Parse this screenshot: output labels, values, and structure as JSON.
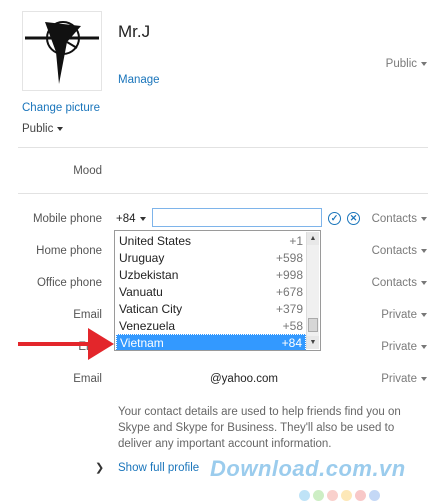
{
  "profile": {
    "name": "Mr.J",
    "manage_link": "Manage",
    "change_picture_link": "Change picture",
    "picture_privacy": "Public",
    "profile_privacy": "Public"
  },
  "mood": {
    "label": "Mood"
  },
  "mobile_phone": {
    "label": "Mobile phone",
    "country_code": "+84",
    "value": "",
    "privacy": "Contacts"
  },
  "home_phone": {
    "label": "Home phone",
    "privacy": "Contacts"
  },
  "office_phone": {
    "label": "Office phone",
    "privacy": "Contacts"
  },
  "emails": [
    {
      "label": "Email",
      "value": "",
      "privacy": "Private"
    },
    {
      "label": "Ema",
      "value": "",
      "privacy": "Private"
    },
    {
      "label": "Email",
      "value": "@yahoo.com",
      "privacy": "Private"
    }
  ],
  "country_dropdown": {
    "items": [
      {
        "country": "United States",
        "code": "+1"
      },
      {
        "country": "Uruguay",
        "code": "+598"
      },
      {
        "country": "Uzbekistan",
        "code": "+998"
      },
      {
        "country": "Vanuatu",
        "code": "+678"
      },
      {
        "country": "Vatican City",
        "code": "+379"
      },
      {
        "country": "Venezuela",
        "code": "+58"
      },
      {
        "country": "Vietnam",
        "code": "+84"
      }
    ],
    "selected_index": 6
  },
  "info_text": "Your contact details are used to help friends find you on Skype and Skype for Business. They'll also be used to deliver any important account information.",
  "show_full_profile": "Show full profile",
  "watermark": "Download.com.vn",
  "colors": {
    "link": "#1a75bb",
    "selection": "#3399ff",
    "arrow": "#e3262b"
  }
}
